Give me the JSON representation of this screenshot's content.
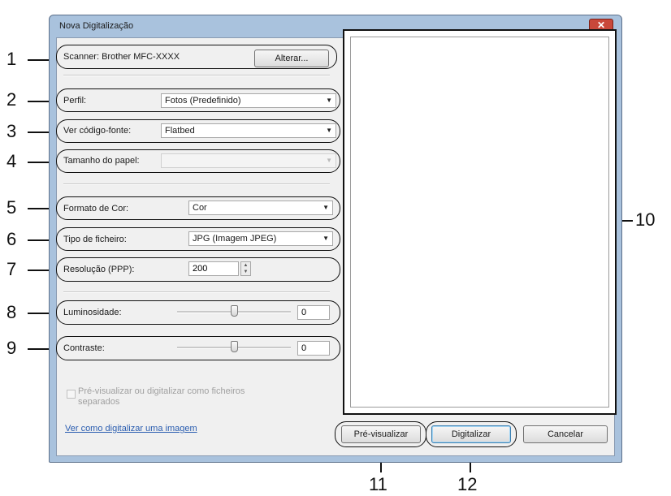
{
  "window": {
    "title": "Nova Digitalização",
    "close_glyph": "✕"
  },
  "scanner": {
    "label": "Scanner: Brother MFC-XXXX",
    "change_button": "Alterar..."
  },
  "profile": {
    "label": "Perfil:",
    "value": "Fotos (Predefinido)"
  },
  "source": {
    "label": "Ver código-fonte:",
    "value": "Flatbed"
  },
  "paper_size": {
    "label": "Tamanho do papel:",
    "value": ""
  },
  "color_format": {
    "label": "Formato de Cor:",
    "value": "Cor"
  },
  "file_type": {
    "label": "Tipo de ficheiro:",
    "value": "JPG (Imagem JPEG)"
  },
  "resolution": {
    "label": "Resolução (PPP):",
    "value": "200"
  },
  "brightness": {
    "label": "Luminosidade:",
    "value": "0",
    "level": 0.5
  },
  "contrast": {
    "label": "Contraste:",
    "value": "0",
    "level": 0.5
  },
  "separate_files": {
    "label_line1": "Pré-visualizar ou digitalizar como ficheiros",
    "label_line2": "separados",
    "checked": false
  },
  "help_link": "Ver como digitalizar uma imagem",
  "buttons": {
    "preview": "Pré-visualizar",
    "scan": "Digitalizar",
    "cancel": "Cancelar"
  },
  "callouts": [
    "1",
    "2",
    "3",
    "4",
    "5",
    "6",
    "7",
    "8",
    "9",
    "10",
    "11",
    "12"
  ]
}
